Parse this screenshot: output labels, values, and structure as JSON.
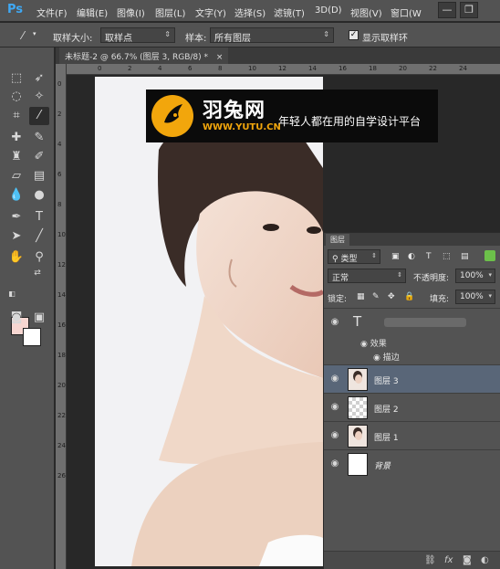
{
  "app": {
    "logo": "Ps"
  },
  "menu": [
    "文件(F)",
    "编辑(E)",
    "图像(I)",
    "图层(L)",
    "文字(Y)",
    "选择(S)",
    "滤镜(T)",
    "3D(D)",
    "视图(V)",
    "窗口(W"
  ],
  "window_controls": {
    "minimize": "—",
    "restore": "❐"
  },
  "options": {
    "sample_size_label": "取样大小:",
    "sample_size_value": "取样点",
    "sample_label": "样本:",
    "sample_value": "所有图层",
    "show_ring_label": "显示取样环",
    "show_ring_checked": true
  },
  "document": {
    "tab_title": "未标题-2 @ 66.7% (图层 3, RGB/8) *",
    "close": "×"
  },
  "rulers": {
    "top": [
      "0",
      "2",
      "4",
      "6",
      "8",
      "10",
      "12",
      "14",
      "16",
      "18",
      "20",
      "22",
      "24"
    ],
    "left": [
      "0",
      "2",
      "4",
      "6",
      "8",
      "10",
      "12",
      "14",
      "16",
      "18",
      "20",
      "22",
      "24",
      "26"
    ]
  },
  "banner": {
    "logo_text": "羽兔网",
    "url": "WWW.YUTU.CN",
    "slogan": "年轻人都在用的自学设计平台"
  },
  "colors": {
    "foreground": "#f7d6d1",
    "background": "#ffffff",
    "selected_layer": "#596678"
  },
  "layers_panel": {
    "tab": "图层",
    "filter_label": "类型",
    "blend_mode": "正常",
    "opacity_label": "不透明度:",
    "opacity_value": "100%",
    "lock_label": "锁定:",
    "fill_label": "填充:",
    "fill_value": "100%",
    "text_layer_icon": "T",
    "effects_label": "效果",
    "stroke_label": "描边",
    "layers": [
      {
        "name": "图层 3",
        "selected": true
      },
      {
        "name": "图层 2",
        "selected": false
      },
      {
        "name": "图层 1",
        "selected": false
      },
      {
        "name": "背景",
        "selected": false
      }
    ]
  }
}
